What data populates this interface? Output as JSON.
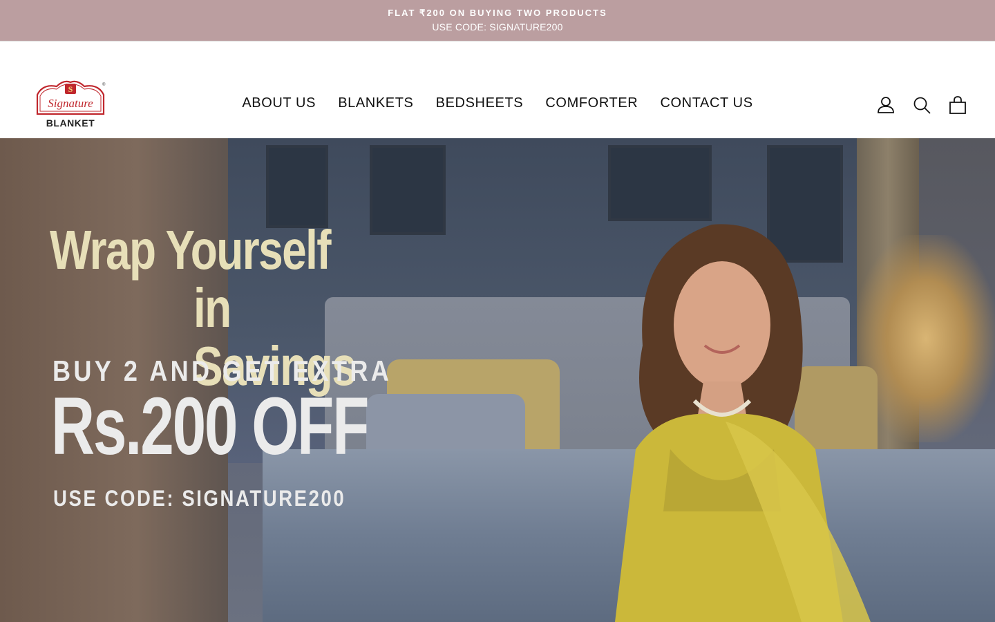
{
  "announcement": {
    "line1": "FLAT ₹200 ON BUYING TWO PRODUCTS",
    "line2": "USE CODE: SIGNATURE200"
  },
  "logo": {
    "script_text": "Signature",
    "wordmark": "BLANKET",
    "monogram": "S"
  },
  "nav": {
    "items": [
      {
        "label": "ABOUT US"
      },
      {
        "label": "BLANKETS"
      },
      {
        "label": "BEDSHEETS"
      },
      {
        "label": "COMFORTER"
      },
      {
        "label": "CONTACT US"
      }
    ]
  },
  "header_icons": [
    {
      "name": "account-icon"
    },
    {
      "name": "search-icon"
    },
    {
      "name": "cart-icon"
    }
  ],
  "hero": {
    "headline_line1": "Wrap Yourself",
    "headline_line2": "in Savings",
    "buy_line": "BUY 2 AND GET EXTRA",
    "offer_line": "Rs.200 OFF",
    "code_line": "USE CODE: SIGNATURE200"
  },
  "colors": {
    "announcement_bg": "#bb9ea0",
    "headline": "#e7dfb8",
    "logo_red": "#c0272d"
  }
}
